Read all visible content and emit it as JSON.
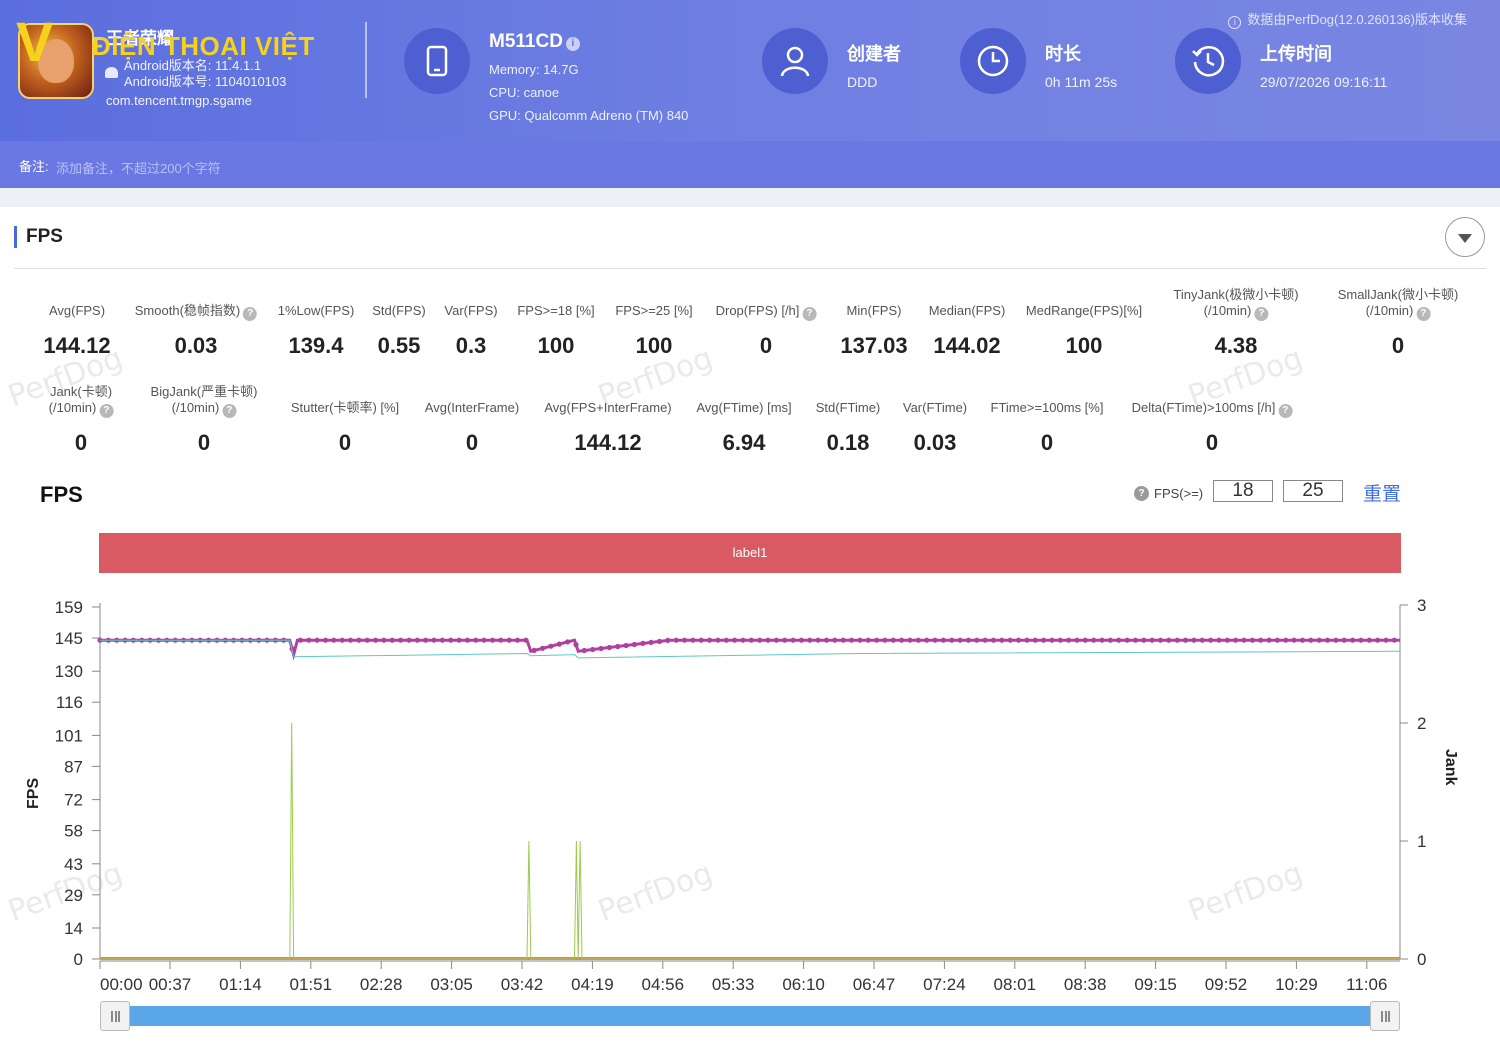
{
  "header": {
    "data_source_note": "数据由PerfDog(12.0.260136)版本收集",
    "logo": {
      "mark": "V",
      "text": "ĐIỆN THOẠI VIỆT"
    },
    "app": {
      "name": "王者荣耀",
      "android_version_name": "Android版本名: 11.4.1.1",
      "android_version_code": "Android版本号: 1104010103",
      "package": "com.tencent.tmgp.sgame"
    },
    "device": {
      "name": "M511CD",
      "info_mark": "i",
      "memory": "Memory: 14.7G",
      "cpu": "CPU: canoe",
      "gpu": "GPU: Qualcomm Adreno (TM) 840"
    },
    "creator": {
      "label": "创建者",
      "value": "DDD"
    },
    "duration": {
      "label": "时长",
      "value": "0h 11m 25s"
    },
    "upload_time": {
      "label": "上传时间",
      "value": "29/07/2026 09:16:11"
    }
  },
  "remark": {
    "label": "备注:",
    "placeholder": "添加备注，不超过200个字符"
  },
  "section": {
    "title": "FPS"
  },
  "stats_row1": [
    {
      "label": "Avg(FPS)",
      "value": "144.12"
    },
    {
      "label": "Smooth(稳帧指数)",
      "help": "?",
      "value": "0.03"
    },
    {
      "label": "1%Low(FPS)",
      "value": "139.4"
    },
    {
      "label": "Std(FPS)",
      "value": "0.55"
    },
    {
      "label": "Var(FPS)",
      "value": "0.3"
    },
    {
      "label": "FPS>=18 [%]",
      "value": "100"
    },
    {
      "label": "FPS>=25 [%]",
      "value": "100"
    },
    {
      "label": "Drop(FPS) [/h]",
      "help": "?",
      "value": "0"
    },
    {
      "label": "Min(FPS)",
      "value": "137.03"
    },
    {
      "label": "Median(FPS)",
      "value": "144.02"
    },
    {
      "label": "MedRange(FPS)[%]",
      "value": "100"
    },
    {
      "label": "TinyJank(极微小卡顿)",
      "sub": "(/10min)",
      "help": "?",
      "value": "4.38"
    },
    {
      "label": "SmallJank(微小卡顿)",
      "sub": "(/10min)",
      "help": "?",
      "value": "0"
    }
  ],
  "stats_row2": [
    {
      "label": "Jank(卡顿)",
      "sub": "(/10min)",
      "help": "?",
      "value": "0"
    },
    {
      "label": "BigJank(严重卡顿)",
      "sub": "(/10min)",
      "help": "?",
      "value": "0"
    },
    {
      "label": "Stutter(卡顿率) [%]",
      "value": "0"
    },
    {
      "label": "Avg(InterFrame)",
      "value": "0"
    },
    {
      "label": "Avg(FPS+InterFrame)",
      "value": "144.12"
    },
    {
      "label": "Avg(FTime) [ms]",
      "value": "6.94"
    },
    {
      "label": "Std(FTime)",
      "value": "0.18"
    },
    {
      "label": "Var(FTime)",
      "value": "0.03"
    },
    {
      "label": "FTime>=100ms [%]",
      "value": "0"
    },
    {
      "label": "Delta(FTime)>100ms [/h]",
      "help": "?",
      "value": "0"
    }
  ],
  "watermark": "PerfDog",
  "chart_controls": {
    "title": "FPS",
    "help": "?",
    "filter_label": "FPS(>=)",
    "filter_value_1": "18",
    "filter_value_2": "25",
    "reset_label": "重置"
  },
  "label_bar": "label1",
  "colors": {
    "fps_line": "#b0409f",
    "jank_line": "#9ccc4a",
    "interframe_line": "#5fc6c6",
    "zero_line": "#e7844a",
    "label_bar": "#d95a63",
    "slider": "#5aa6e6"
  },
  "chart_data": {
    "type": "line",
    "title": "FPS",
    "ylabel": "FPS",
    "y2label": "Jank",
    "y_ticks": [
      0,
      14,
      29,
      43,
      58,
      72,
      87,
      101,
      116,
      130,
      145,
      159
    ],
    "y2_ticks": [
      0,
      1,
      2,
      3
    ],
    "ylim": [
      0,
      159
    ],
    "y2lim": [
      0,
      3
    ],
    "x_ticks": [
      "00:00",
      "00:37",
      "01:14",
      "01:51",
      "02:28",
      "03:05",
      "03:42",
      "04:19",
      "04:56",
      "05:33",
      "06:10",
      "06:47",
      "07:24",
      "08:01",
      "08:38",
      "09:15",
      "09:52",
      "10:29",
      "11:06"
    ],
    "x_range_seconds": [
      0,
      685
    ],
    "series": [
      {
        "name": "FPS",
        "x_seconds": [
          0,
          100,
          102,
          104,
          225,
          227,
          250,
          252,
          300,
          685
        ],
        "values": [
          144,
          144,
          137.5,
          144,
          144,
          139,
          144,
          139,
          144,
          144
        ]
      },
      {
        "name": "InterFrame",
        "x_seconds": [
          0,
          100,
          102,
          225,
          227,
          250,
          252,
          400,
          685
        ],
        "values": [
          144,
          144,
          136.5,
          138,
          137,
          137.5,
          136,
          138,
          139
        ]
      },
      {
        "name": "Jank",
        "x_seconds": [
          0,
          100,
          101,
          102,
          225,
          226,
          227,
          250,
          251,
          252,
          253,
          254,
          685
        ],
        "values": [
          0,
          0,
          2,
          0,
          0,
          1,
          0,
          0,
          1,
          0,
          1,
          0,
          0
        ]
      }
    ],
    "grid": false,
    "legend": "none"
  }
}
